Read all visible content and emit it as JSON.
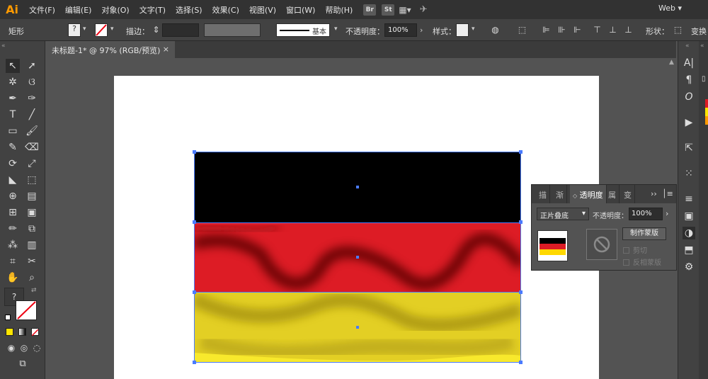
{
  "app": {
    "logo": "Ai",
    "workspace": "Web"
  },
  "menu": [
    "文件(F)",
    "编辑(E)",
    "对象(O)",
    "文字(T)",
    "选择(S)",
    "效果(C)",
    "视图(V)",
    "窗口(W)",
    "帮助(H)"
  ],
  "bridge_chips": [
    "Br",
    "St"
  ],
  "controlbar": {
    "object_type": "矩形",
    "stroke_label": "描边：",
    "brush_label": "基本",
    "opacity_label": "不透明度：",
    "opacity_value": "100%",
    "style_label": "样式：",
    "shape_label": "形状：",
    "transform_label": "变换"
  },
  "document": {
    "tab_title": "未标题-1* @ 97% (RGB/预览)",
    "close_glyph": "×"
  },
  "flag": {
    "colors": [
      "#000000",
      "#dd1c25",
      "#e8d42a"
    ]
  },
  "panel": {
    "tabs": [
      "描",
      "渐",
      "透明度",
      "属",
      "变"
    ],
    "active_tab": "透明度",
    "blend_mode": "正片叠底",
    "opacity_label": "不透明度：",
    "opacity_value": "100%",
    "make_mask_label": "制作蒙版",
    "clip_label": "剪切",
    "invert_mask_label": "反相蒙版"
  },
  "colors": {
    "accent": "#ff9a00",
    "selection": "#4a7bff",
    "fill_swatch": "#ffe600"
  }
}
